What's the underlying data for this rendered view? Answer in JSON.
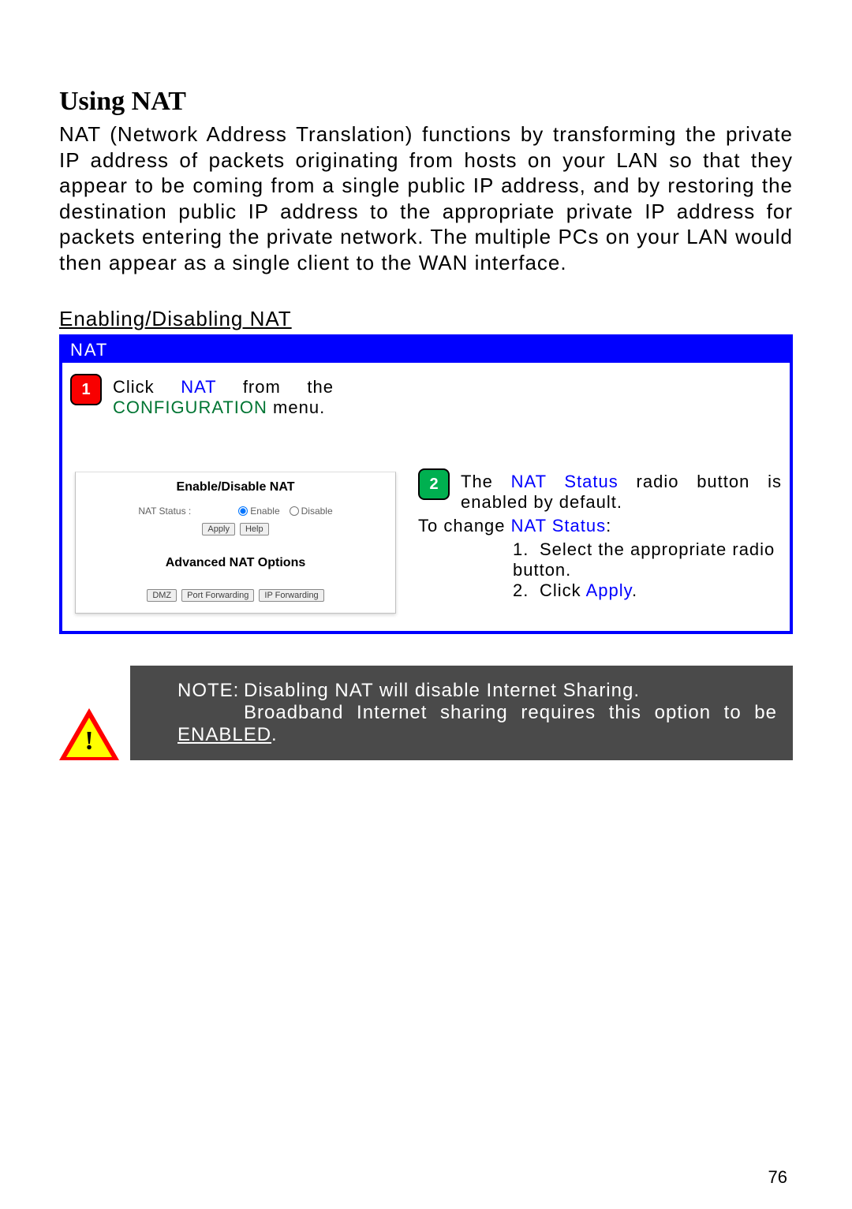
{
  "heading": "Using NAT",
  "intro": "NAT (Network Address Translation) functions by transforming the private IP address of packets originating from hosts on your LAN so that they appear to be coming from a single public IP address, and by restoring the destination public IP address to the appropriate private IP address for packets entering the private network. The multiple PCs on your LAN would then appear as a single client to the WAN interface.",
  "sub_heading": "Enabling/Disabling NAT",
  "figure": {
    "title": "NAT",
    "step1": {
      "badge": "1",
      "pre": "Click ",
      "link": "NAT",
      "mid": " from the ",
      "menu": "CONFIGURATION",
      "post": " menu."
    },
    "panel": {
      "heading1": "Enable/Disable NAT",
      "status_label": "NAT Status :",
      "enable": "Enable",
      "disable": "Disable",
      "apply": "Apply",
      "help": "Help",
      "heading2": "Advanced NAT Options",
      "btn_dmz": "DMZ",
      "btn_pf": "Port Forwarding",
      "btn_ipf": "IP Forwarding"
    },
    "step2": {
      "badge": "2",
      "line1_pre": "The ",
      "line1_link": "NAT Status",
      "line1_post": " radio button is enabled by default.",
      "tochange_pre": "To change ",
      "tochange_link": "NAT Status",
      "tochange_post": ":",
      "item1_num": "1.",
      "item1_text": "Select the appropriate radio button.",
      "item2_num": "2.",
      "item2_pre": "Click ",
      "item2_link": "Apply",
      "item2_post": "."
    }
  },
  "note": {
    "label": "NOTE:",
    "line1": "Disabling NAT will disable Internet Sharing.",
    "line2_pre": "Broadband Internet sharing requires this option to be ",
    "line2_em": "ENABLED",
    "line2_post": "."
  },
  "page_num": "76"
}
